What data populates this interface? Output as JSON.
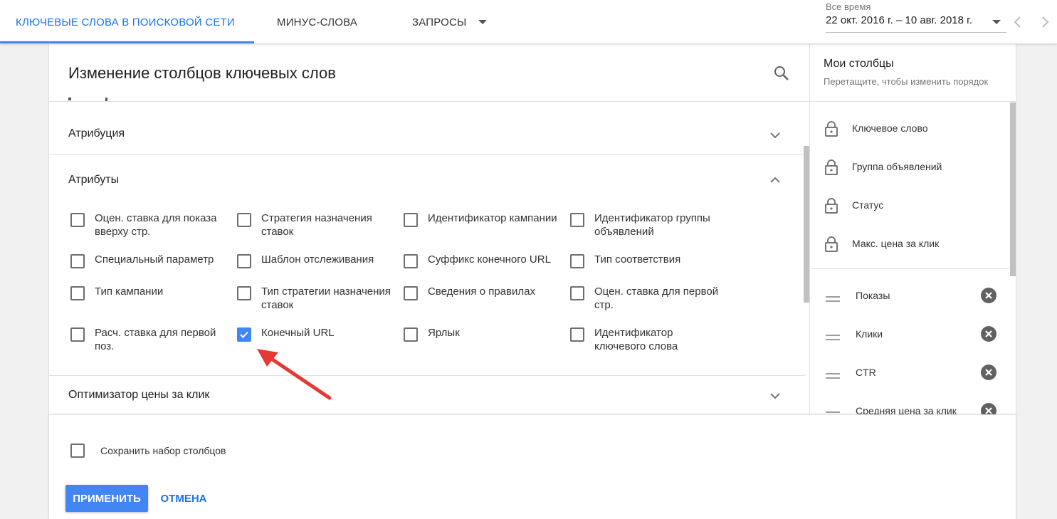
{
  "tabs": [
    {
      "label": "КЛЮЧЕВЫЕ СЛОВА В ПОИСКОВОЙ СЕТИ",
      "active": true
    },
    {
      "label": "МИНУС-СЛОВА",
      "active": false
    },
    {
      "label": "ЗАПРОСЫ",
      "active": false,
      "has_dropdown": true
    }
  ],
  "date_range": {
    "label": "Все время",
    "value": "22 окт. 2016 г. – 10 авг. 2018 г."
  },
  "panel": {
    "title": "Изменение столбцов ключевых слов",
    "sections": [
      {
        "label": "Атрибуция",
        "expanded": false
      },
      {
        "label": "Атрибуты",
        "expanded": true
      },
      {
        "label": "Оптимизатор цены за клик",
        "expanded": false
      }
    ],
    "options": [
      {
        "label": "Оцен. ставка для показа вверху стр.",
        "checked": false
      },
      {
        "label": "Стратегия назначения ставок",
        "checked": false
      },
      {
        "label": "Идентификатор кампании",
        "checked": false
      },
      {
        "label": "Идентификатор группы объявлений",
        "checked": false
      },
      {
        "label": "Специальный параметр",
        "checked": false
      },
      {
        "label": "Шаблон отслеживания",
        "checked": false
      },
      {
        "label": "Суффикс конечного URL",
        "checked": false
      },
      {
        "label": "Тип соответствия",
        "checked": false
      },
      {
        "label": "Тип кампании",
        "checked": false
      },
      {
        "label": "Тип стратегии назначения ставок",
        "checked": false
      },
      {
        "label": "Сведения о правилах",
        "checked": false
      },
      {
        "label": "Оцен. ставка для первой стр.",
        "checked": false
      },
      {
        "label": "Расч. ставка для первой поз.",
        "checked": false
      },
      {
        "label": "Конечный URL",
        "checked": true
      },
      {
        "label": "Ярлык",
        "checked": false
      },
      {
        "label": "Идентификатор ключевого слова",
        "checked": false
      }
    ]
  },
  "my_columns": {
    "title": "Мои столбцы",
    "subtitle": "Перетащите, чтобы изменить порядок",
    "locked": [
      "Ключевое слово",
      "Группа объявлений",
      "Статус",
      "Макс. цена за клик"
    ],
    "movable": [
      "Показы",
      "Клики",
      "CTR",
      "Средняя цена за клик"
    ]
  },
  "footer": {
    "save_set_label": "Сохранить набор столбцов",
    "save_set_checked": false,
    "apply_label": "ПРИМЕНИТЬ",
    "cancel_label": "ОТМЕНА"
  },
  "colors": {
    "accent": "#4285f4",
    "active_tab": "#1a73e8",
    "annotation_arrow": "#e53935"
  },
  "icons": {
    "search": "search-icon",
    "expand": "chevron-down-icon",
    "collapse": "chevron-up-icon",
    "lock": "lock-icon",
    "drag": "drag-handle-icon",
    "remove": "remove-circle-icon"
  }
}
